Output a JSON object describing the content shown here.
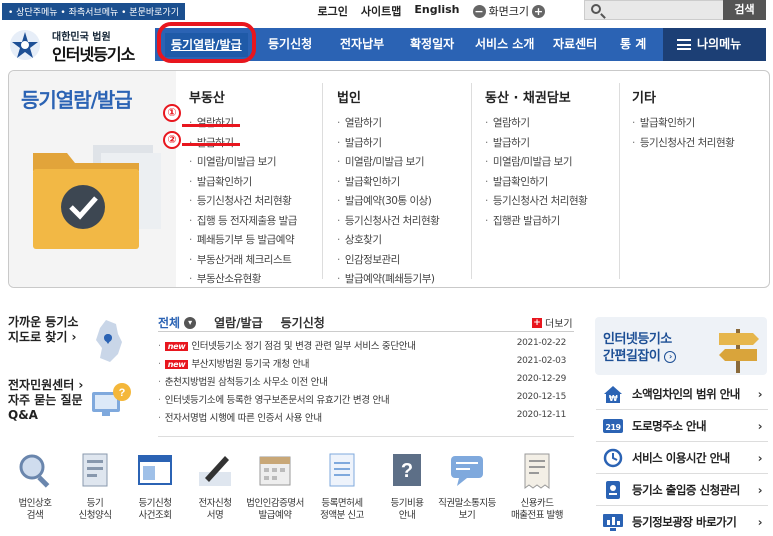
{
  "topbar": {
    "skip_links": "• 상단주메뉴 • 좌측서브메뉴 • 본문바로가기",
    "login": "로그인",
    "sitemap": "사이트맵",
    "english": "English",
    "zoom_label": "화면크기",
    "zoom_minus": "−",
    "zoom_plus": "+",
    "search_button": "검색"
  },
  "logo": {
    "line1": "대한민국 법원",
    "line2": "인터넷등기소"
  },
  "gnb": {
    "items": [
      "등기열람/발급",
      "등기신청",
      "전자납부",
      "확정일자",
      "서비스 소개",
      "자료센터",
      "통 계"
    ],
    "my_menu": "나의메뉴"
  },
  "mega": {
    "title": "등기열람/발급",
    "annotations": [
      "①",
      "②"
    ],
    "columns": [
      {
        "heading": "부동산",
        "items": [
          "열람하기",
          "발급하기",
          "미열람/미발급 보기",
          "발급확인하기",
          "등기신청사건 처리현황",
          "집행 등 전자제출용 발급",
          "폐쇄등기부 등 발급예약",
          "부동산거래 체크리스트",
          "부동산소유현황"
        ]
      },
      {
        "heading": "법인",
        "items": [
          "열람하기",
          "발급하기",
          "미열람/미발급 보기",
          "발급확인하기",
          "발급예약(30통 이상)",
          "등기신청사건 처리현황",
          "상호찾기",
          "인감정보관리",
          "발급예약(폐쇄등기부)"
        ]
      },
      {
        "heading": "동산 · 채권담보",
        "items": [
          "열람하기",
          "발급하기",
          "미열람/미발급 보기",
          "발급확인하기",
          "등기신청사건 처리현황",
          "집행관 발급하기"
        ]
      },
      {
        "heading": "기타",
        "items": [
          "발급확인하기",
          "등기신청사건 처리현황"
        ]
      }
    ]
  },
  "left": {
    "nearby_line1": "가까운 등기소",
    "nearby_line2": "지도로 찾기 ›",
    "civil_line1": "전자민원센터 ›",
    "civil_line2": "자주 묻는 질문",
    "civil_line3": "Q&A"
  },
  "news": {
    "tabs": [
      "전체",
      "열람/발급",
      "등기신청"
    ],
    "more": "더보기",
    "new_badge": "new",
    "items": [
      {
        "text": "인터넷등기소 정기 점검 및 변경 관련 일부 서비스 중단안내",
        "date": "2021-02-22",
        "new": true
      },
      {
        "text": "부산지방법원 등기국 개청 안내",
        "date": "2021-02-03",
        "new": true
      },
      {
        "text": "춘천지방법원 삼척등기소 사무소 이전 안내",
        "date": "2020-12-29",
        "new": false
      },
      {
        "text": "인터넷등기소에 등록한 영구보존문서의 유효기간 변경 안내",
        "date": "2020-12-15",
        "new": false
      },
      {
        "text": "전자서명법 시행에 따른 인증서 사용 안내",
        "date": "2020-12-11",
        "new": false
      }
    ]
  },
  "guide": {
    "line1": "인터넷등기소",
    "line2": "간편길잡이"
  },
  "side_links": [
    "소액임차인의 범위 안내",
    "도로명주소 안내",
    "서비스 이용시간 안내",
    "등기소 출입증 신청관리",
    "등기정보광장 바로가기"
  ],
  "quick": [
    {
      "l1": "법인상호",
      "l2": "검색"
    },
    {
      "l1": "등기",
      "l2": "신청양식"
    },
    {
      "l1": "등기신청",
      "l2": "사건조회"
    },
    {
      "l1": "전자신청",
      "l2": "서명"
    },
    {
      "l1": "법인인감증명서",
      "l2": "발급예약"
    },
    {
      "l1": "등록면허세",
      "l2": "정액분 신고"
    },
    {
      "l1": "등기비용",
      "l2": "안내"
    },
    {
      "l1": "직권말소통지등",
      "l2": "보기"
    },
    {
      "l1": "신용카드",
      "l2": "매출전표 발행"
    }
  ],
  "colors": {
    "primary": "#2b63b4",
    "accent_red": "#e8161e",
    "dark_navy": "#1c3f75"
  }
}
